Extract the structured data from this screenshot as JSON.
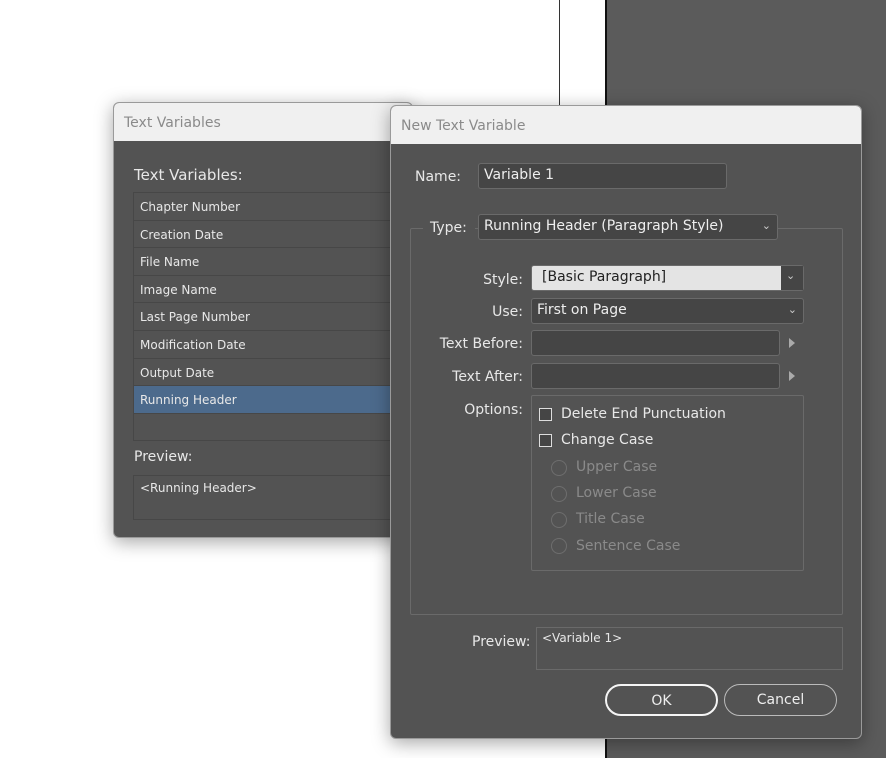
{
  "text_variables_dialog": {
    "title": "Text Variables",
    "list_label": "Text Variables:",
    "items": [
      "Chapter Number",
      "Creation Date",
      "File Name",
      "Image Name",
      "Last Page Number",
      "Modification Date",
      "Output Date",
      "Running Header"
    ],
    "selected": "Running Header",
    "preview_label": "Preview:",
    "preview": "<Running Header>"
  },
  "new_variable_dialog": {
    "title": "New Text Variable",
    "name_label": "Name:",
    "name_value": "Variable 1",
    "type_label": "Type:",
    "type_value": "Running Header (Paragraph Style)",
    "style_label": "Style:",
    "style_value": "[Basic Paragraph]",
    "use_label": "Use:",
    "use_value": "First on Page",
    "text_before_label": "Text Before:",
    "text_before_value": "",
    "text_after_label": "Text After:",
    "text_after_value": "",
    "options_label": "Options:",
    "delete_end_punctuation": "Delete End Punctuation",
    "change_case": "Change Case",
    "case_options": [
      "Upper Case",
      "Lower Case",
      "Title Case",
      "Sentence Case"
    ],
    "preview_label": "Preview:",
    "preview": "<Variable 1>",
    "ok": "OK",
    "cancel": "Cancel"
  }
}
